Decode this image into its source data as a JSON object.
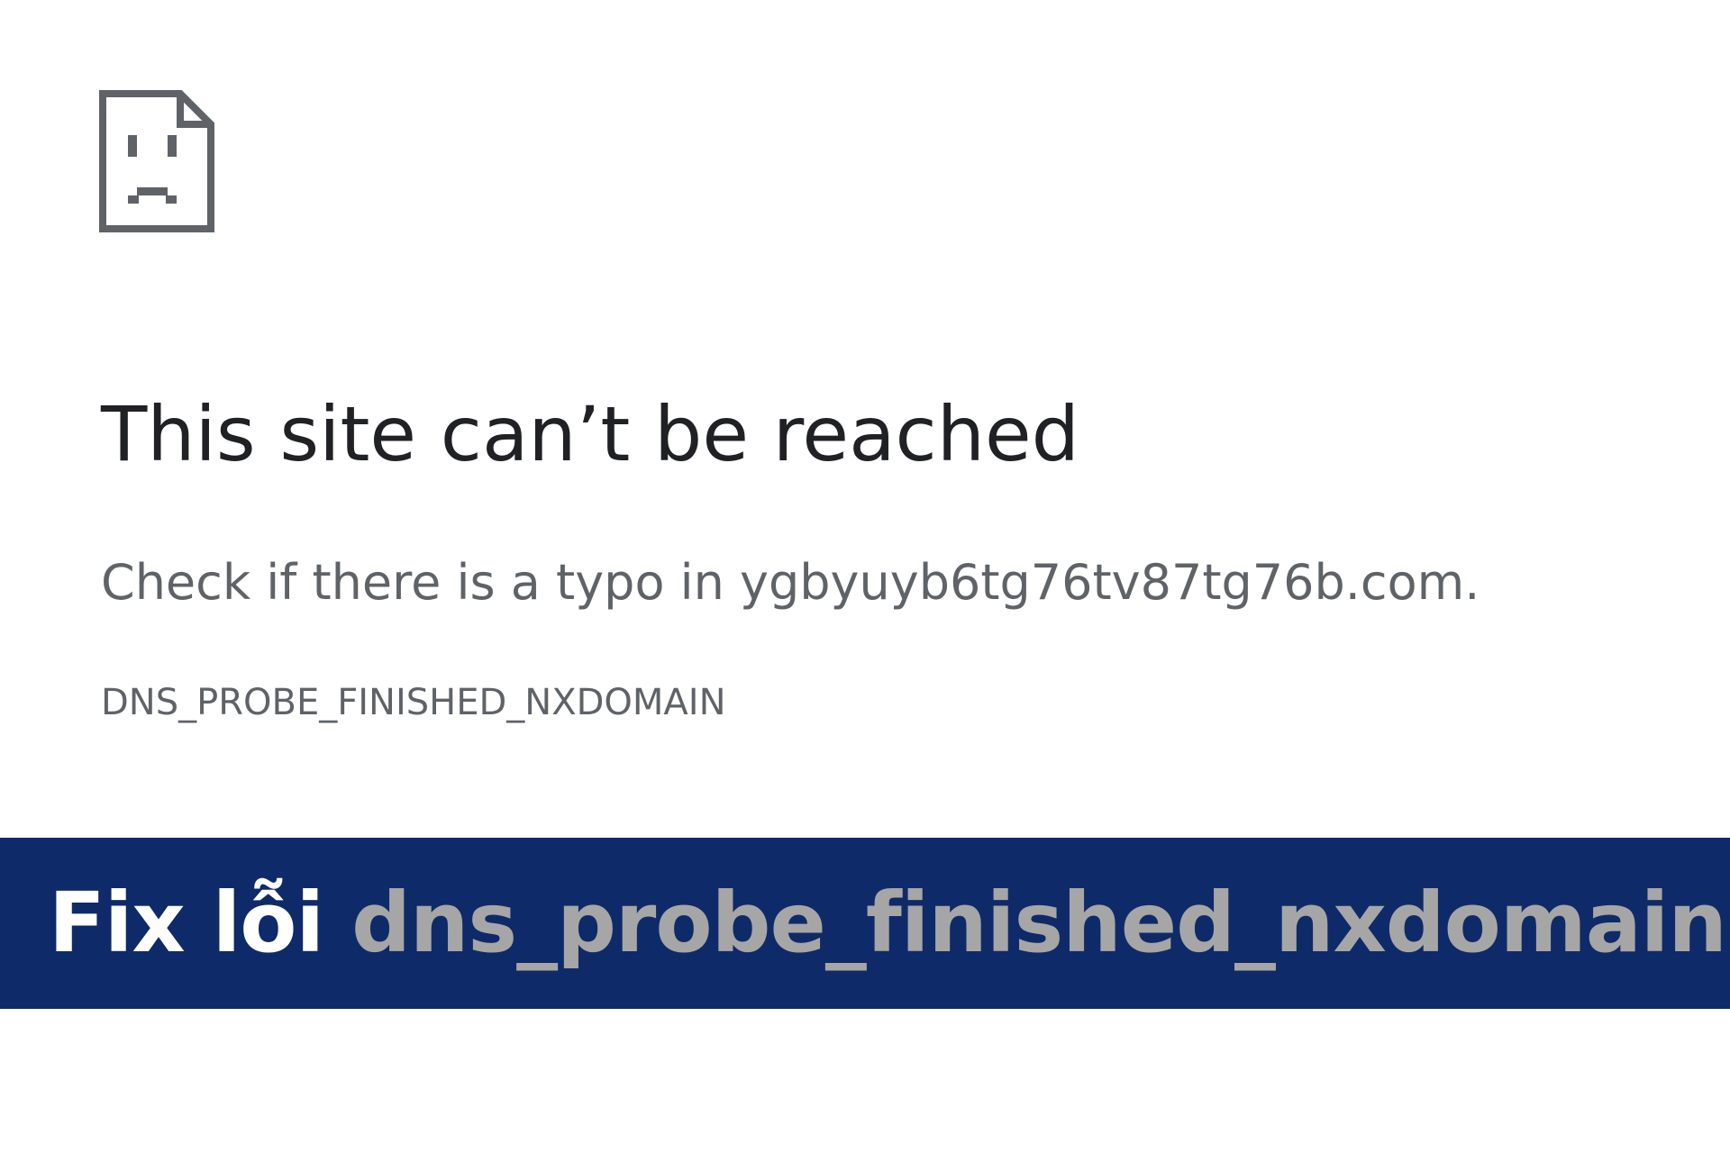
{
  "error_page": {
    "icon": "sad-page-icon",
    "headline": "This site can’t be reached",
    "message": "Check if there is a typo in ygbyuyb6tg76tv87tg76b.com.",
    "error_code": "DNS_PROBE_FINISHED_NXDOMAIN"
  },
  "banner": {
    "prefix": "Fix lỗi",
    "keyword": "dns_probe_finished_nxdomain",
    "background_color": "#0f2a68",
    "prefix_color": "#ffffff",
    "keyword_color": "#a6a6a6"
  }
}
